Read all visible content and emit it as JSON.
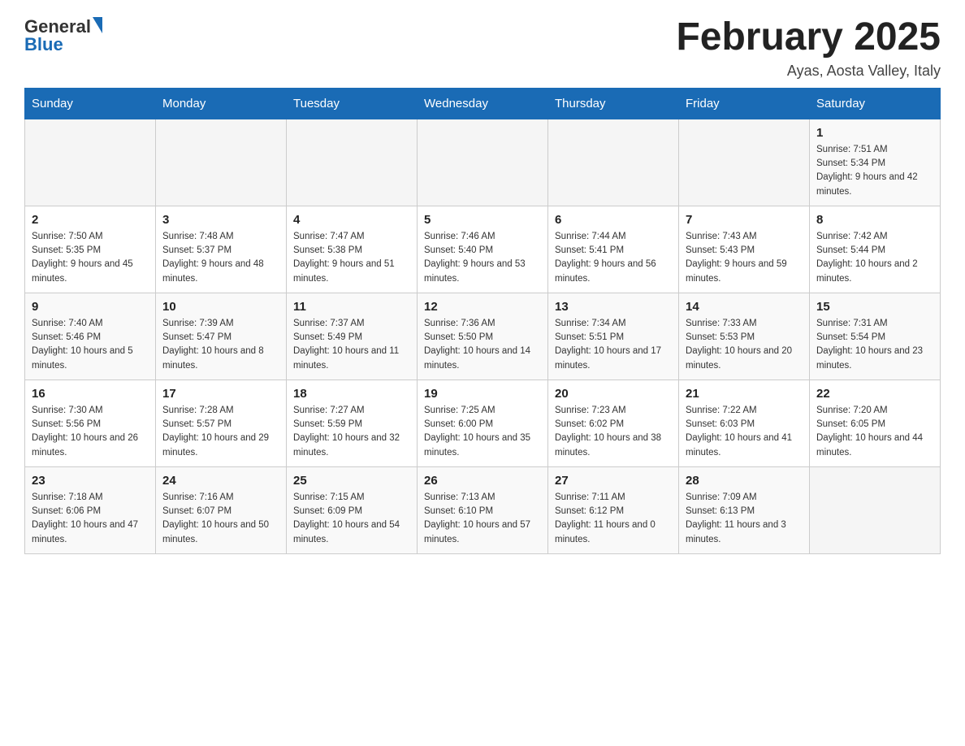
{
  "header": {
    "logo_general": "General",
    "logo_blue": "Blue",
    "calendar_title": "February 2025",
    "subtitle": "Ayas, Aosta Valley, Italy"
  },
  "weekdays": [
    "Sunday",
    "Monday",
    "Tuesday",
    "Wednesday",
    "Thursday",
    "Friday",
    "Saturday"
  ],
  "weeks": [
    [
      {
        "day": "",
        "info": ""
      },
      {
        "day": "",
        "info": ""
      },
      {
        "day": "",
        "info": ""
      },
      {
        "day": "",
        "info": ""
      },
      {
        "day": "",
        "info": ""
      },
      {
        "day": "",
        "info": ""
      },
      {
        "day": "1",
        "info": "Sunrise: 7:51 AM\nSunset: 5:34 PM\nDaylight: 9 hours and 42 minutes."
      }
    ],
    [
      {
        "day": "2",
        "info": "Sunrise: 7:50 AM\nSunset: 5:35 PM\nDaylight: 9 hours and 45 minutes."
      },
      {
        "day": "3",
        "info": "Sunrise: 7:48 AM\nSunset: 5:37 PM\nDaylight: 9 hours and 48 minutes."
      },
      {
        "day": "4",
        "info": "Sunrise: 7:47 AM\nSunset: 5:38 PM\nDaylight: 9 hours and 51 minutes."
      },
      {
        "day": "5",
        "info": "Sunrise: 7:46 AM\nSunset: 5:40 PM\nDaylight: 9 hours and 53 minutes."
      },
      {
        "day": "6",
        "info": "Sunrise: 7:44 AM\nSunset: 5:41 PM\nDaylight: 9 hours and 56 minutes."
      },
      {
        "day": "7",
        "info": "Sunrise: 7:43 AM\nSunset: 5:43 PM\nDaylight: 9 hours and 59 minutes."
      },
      {
        "day": "8",
        "info": "Sunrise: 7:42 AM\nSunset: 5:44 PM\nDaylight: 10 hours and 2 minutes."
      }
    ],
    [
      {
        "day": "9",
        "info": "Sunrise: 7:40 AM\nSunset: 5:46 PM\nDaylight: 10 hours and 5 minutes."
      },
      {
        "day": "10",
        "info": "Sunrise: 7:39 AM\nSunset: 5:47 PM\nDaylight: 10 hours and 8 minutes."
      },
      {
        "day": "11",
        "info": "Sunrise: 7:37 AM\nSunset: 5:49 PM\nDaylight: 10 hours and 11 minutes."
      },
      {
        "day": "12",
        "info": "Sunrise: 7:36 AM\nSunset: 5:50 PM\nDaylight: 10 hours and 14 minutes."
      },
      {
        "day": "13",
        "info": "Sunrise: 7:34 AM\nSunset: 5:51 PM\nDaylight: 10 hours and 17 minutes."
      },
      {
        "day": "14",
        "info": "Sunrise: 7:33 AM\nSunset: 5:53 PM\nDaylight: 10 hours and 20 minutes."
      },
      {
        "day": "15",
        "info": "Sunrise: 7:31 AM\nSunset: 5:54 PM\nDaylight: 10 hours and 23 minutes."
      }
    ],
    [
      {
        "day": "16",
        "info": "Sunrise: 7:30 AM\nSunset: 5:56 PM\nDaylight: 10 hours and 26 minutes."
      },
      {
        "day": "17",
        "info": "Sunrise: 7:28 AM\nSunset: 5:57 PM\nDaylight: 10 hours and 29 minutes."
      },
      {
        "day": "18",
        "info": "Sunrise: 7:27 AM\nSunset: 5:59 PM\nDaylight: 10 hours and 32 minutes."
      },
      {
        "day": "19",
        "info": "Sunrise: 7:25 AM\nSunset: 6:00 PM\nDaylight: 10 hours and 35 minutes."
      },
      {
        "day": "20",
        "info": "Sunrise: 7:23 AM\nSunset: 6:02 PM\nDaylight: 10 hours and 38 minutes."
      },
      {
        "day": "21",
        "info": "Sunrise: 7:22 AM\nSunset: 6:03 PM\nDaylight: 10 hours and 41 minutes."
      },
      {
        "day": "22",
        "info": "Sunrise: 7:20 AM\nSunset: 6:05 PM\nDaylight: 10 hours and 44 minutes."
      }
    ],
    [
      {
        "day": "23",
        "info": "Sunrise: 7:18 AM\nSunset: 6:06 PM\nDaylight: 10 hours and 47 minutes."
      },
      {
        "day": "24",
        "info": "Sunrise: 7:16 AM\nSunset: 6:07 PM\nDaylight: 10 hours and 50 minutes."
      },
      {
        "day": "25",
        "info": "Sunrise: 7:15 AM\nSunset: 6:09 PM\nDaylight: 10 hours and 54 minutes."
      },
      {
        "day": "26",
        "info": "Sunrise: 7:13 AM\nSunset: 6:10 PM\nDaylight: 10 hours and 57 minutes."
      },
      {
        "day": "27",
        "info": "Sunrise: 7:11 AM\nSunset: 6:12 PM\nDaylight: 11 hours and 0 minutes."
      },
      {
        "day": "28",
        "info": "Sunrise: 7:09 AM\nSunset: 6:13 PM\nDaylight: 11 hours and 3 minutes."
      },
      {
        "day": "",
        "info": ""
      }
    ]
  ]
}
